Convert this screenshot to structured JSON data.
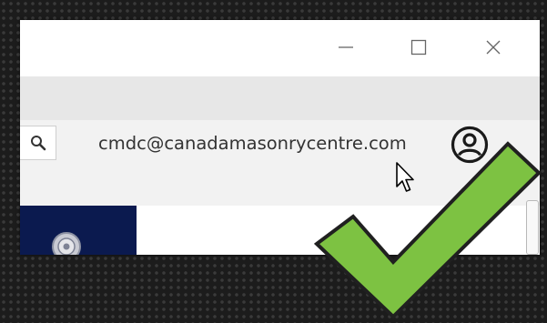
{
  "window": {
    "controls": {
      "minimize_icon": "minimize-icon",
      "maximize_icon": "maximize-icon",
      "close_icon": "close-icon"
    }
  },
  "header": {
    "search_icon": "search-icon",
    "user_email": "cmdc@canadamasonrycentre.com",
    "account_icon": "account-icon"
  },
  "overlay": {
    "checkmark_icon": "checkmark-icon",
    "checkmark_color": "#7dc242"
  },
  "colors": {
    "banner": "#0b1a4f",
    "band": "#e7e7e7",
    "header_row": "#f2f2f2"
  }
}
